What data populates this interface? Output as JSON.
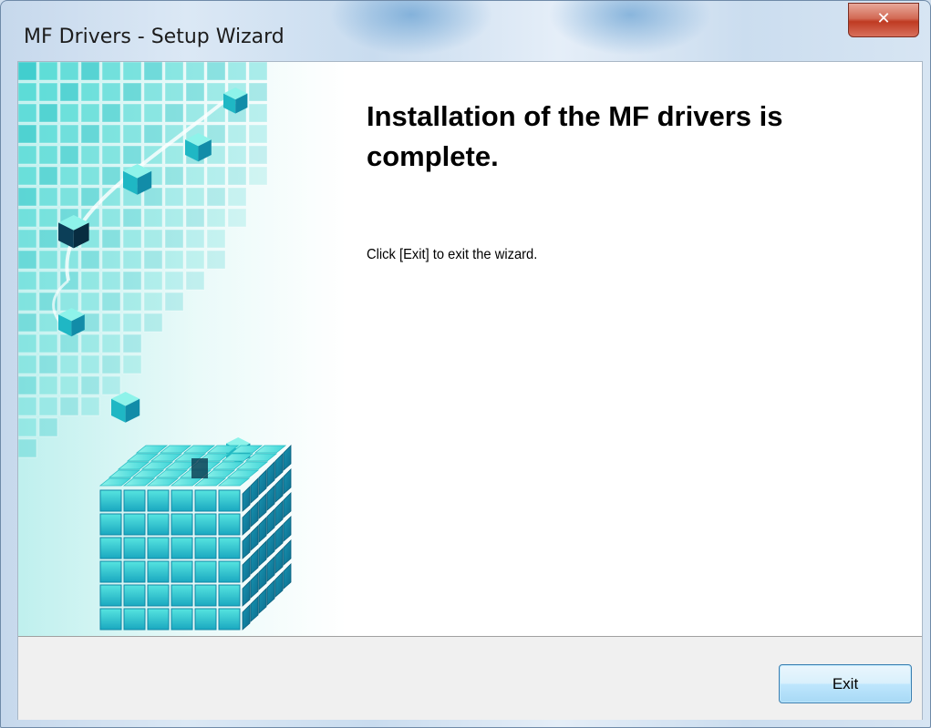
{
  "window": {
    "title": "MF Drivers - Setup Wizard",
    "close_glyph": "✕"
  },
  "content": {
    "heading": "Installation of the MF drivers is complete.",
    "message": "Click [Exit] to exit the wizard."
  },
  "buttons": {
    "exit_label": "Exit"
  },
  "colors": {
    "accent": "#1fc4c8",
    "button_border": "#3c7fb1",
    "close_button": "#c8452f"
  },
  "icons": {
    "close": "close-icon",
    "side_art": "cube-graphic"
  }
}
